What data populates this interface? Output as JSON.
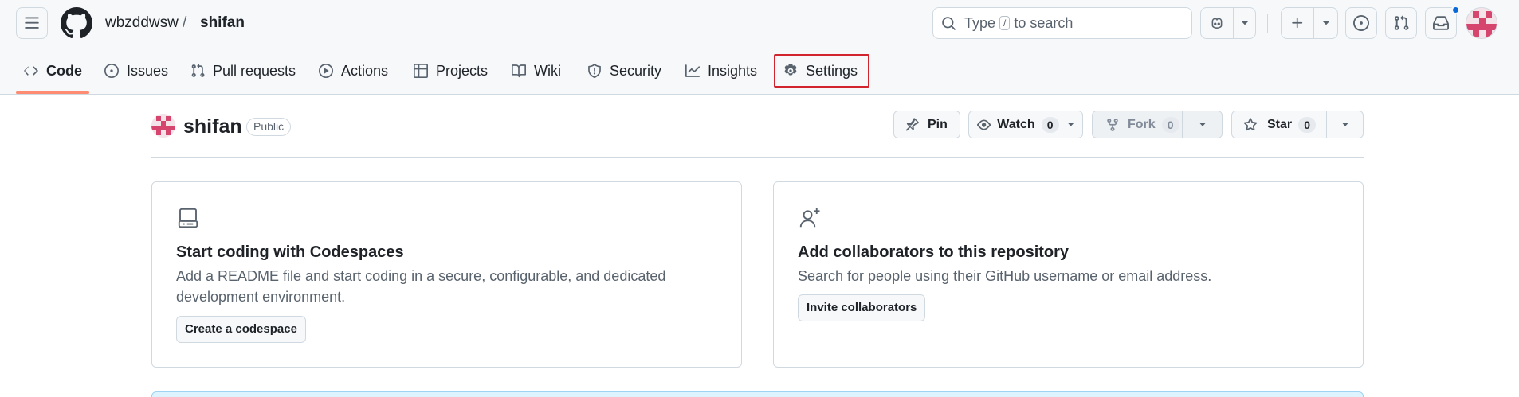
{
  "header": {
    "owner": "wbzddwsw",
    "separator": "/",
    "repo": "shifan",
    "search": {
      "prefix": "Type",
      "key": "/",
      "suffix": "to search"
    }
  },
  "nav": {
    "tabs": [
      {
        "label": "Code",
        "icon": "code-icon",
        "selected": true
      },
      {
        "label": "Issues",
        "icon": "issue-icon"
      },
      {
        "label": "Pull requests",
        "icon": "pull-request-icon"
      },
      {
        "label": "Actions",
        "icon": "play-icon"
      },
      {
        "label": "Projects",
        "icon": "table-icon"
      },
      {
        "label": "Wiki",
        "icon": "book-icon"
      },
      {
        "label": "Security",
        "icon": "shield-icon"
      },
      {
        "label": "Insights",
        "icon": "graph-icon"
      },
      {
        "label": "Settings",
        "icon": "gear-icon",
        "highlighted": true
      }
    ]
  },
  "repo_header": {
    "name": "shifan",
    "visibility": "Public",
    "pin_label": "Pin",
    "watch_label": "Watch",
    "watch_count": "0",
    "fork_label": "Fork",
    "fork_count": "0",
    "star_label": "Star",
    "star_count": "0"
  },
  "cards": {
    "codespaces": {
      "title": "Start coding with Codespaces",
      "description": "Add a README file and start coding in a secure, configurable, and dedicated development environment.",
      "button": "Create a codespace"
    },
    "collaborators": {
      "title": "Add collaborators to this repository",
      "description": "Search for people using their GitHub username or email address.",
      "button": "Invite collaborators"
    }
  },
  "colors": {
    "accent_underline": "#fd8c73",
    "highlight_box": "#d1242f",
    "notification": "#0969da",
    "avatar_pink": "#d6456e"
  }
}
